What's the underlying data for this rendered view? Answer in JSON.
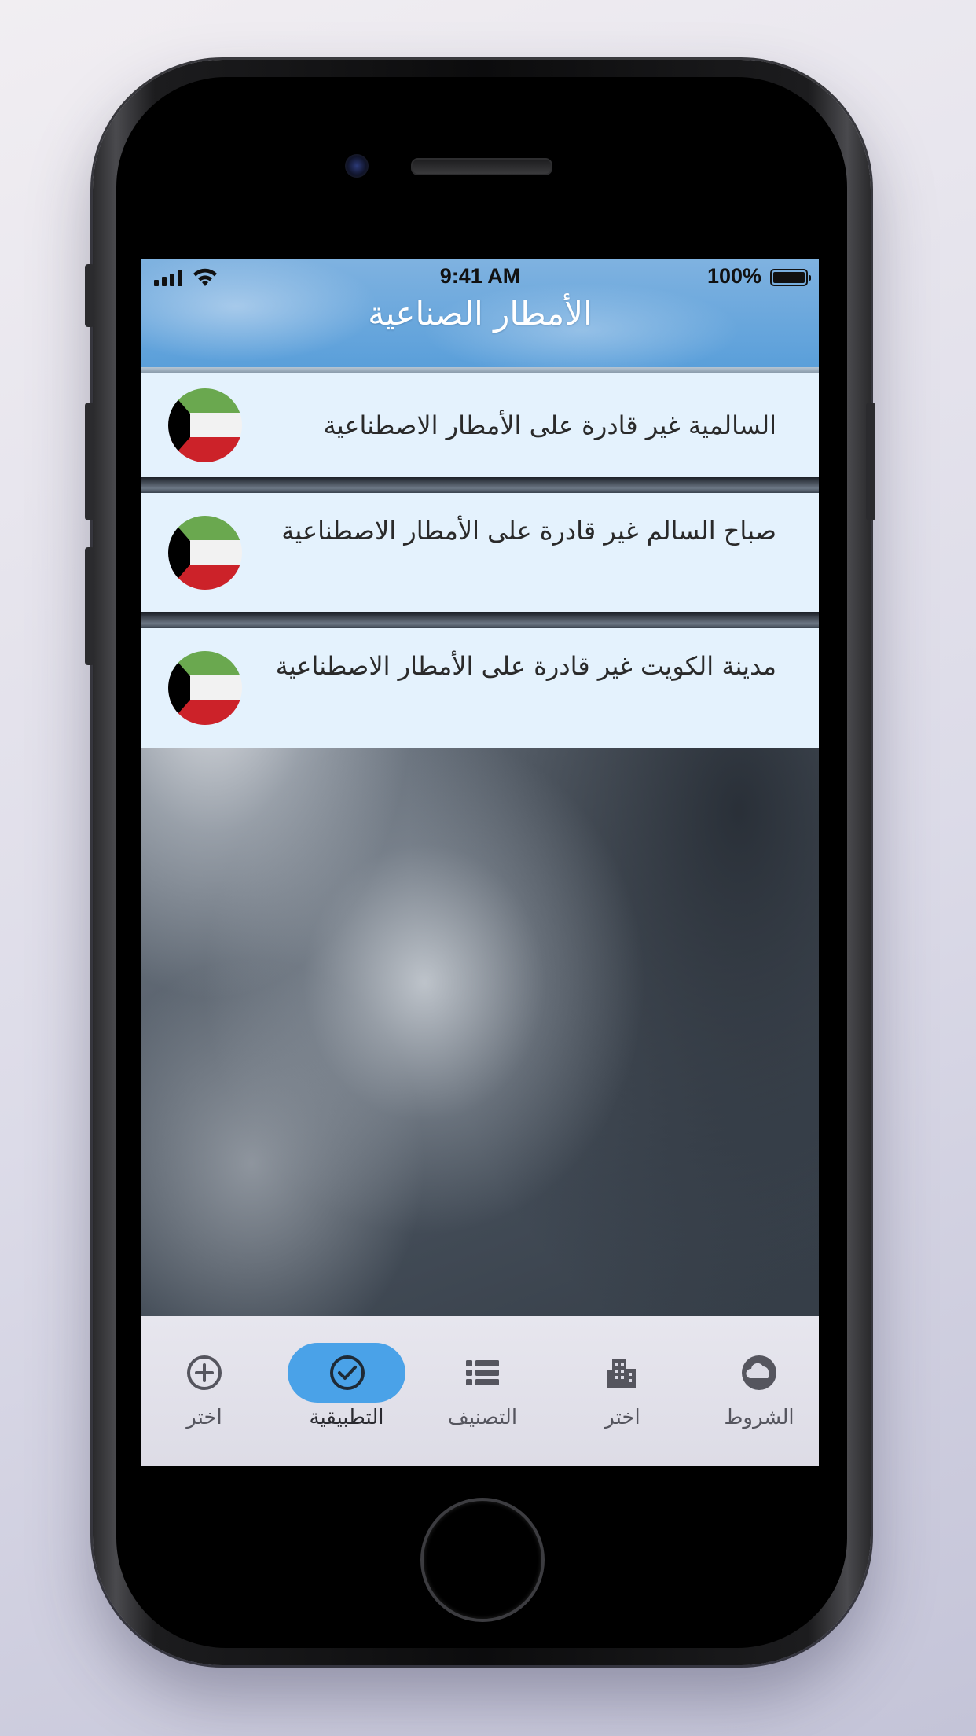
{
  "status_bar": {
    "time": "9:41 AM",
    "battery_percent": "100%",
    "battery_level": 1.0,
    "signal_icon": "cellular-signal-icon",
    "wifi_icon": "wifi-icon",
    "battery_icon": "battery-icon"
  },
  "header": {
    "title": "الأمطار الصناعية"
  },
  "list": [
    {
      "text": "السالمية غير قادرة على الأمطار الاصطناعية",
      "icon": "kuwait-flag-icon"
    },
    {
      "text": "صباح السالم غير قادرة على الأمطار الاصطناعية",
      "icon": "kuwait-flag-icon"
    },
    {
      "text": "مدينة الكويت غير قادرة على الأمطار الاصطناعية",
      "icon": "kuwait-flag-icon"
    }
  ],
  "tabbar": {
    "active_color": "#4aa2e8",
    "tabs": [
      {
        "label": "اختر",
        "icon": "plus-circle-icon",
        "active": false
      },
      {
        "label": "التطبيقية",
        "icon": "check-circle-icon",
        "active": true
      },
      {
        "label": "التصنيف",
        "icon": "list-icon",
        "active": false
      },
      {
        "label": "اختر",
        "icon": "building-icon",
        "active": false
      },
      {
        "label": "الشروط",
        "icon": "cloud-icon",
        "active": false
      }
    ]
  },
  "colors": {
    "header_blue": "#5a9fda",
    "card_background": "#e4f2fd",
    "flag_green": "#6aa84f",
    "flag_white": "#f2f2f2",
    "flag_red": "#cc2229",
    "flag_black": "#000000"
  }
}
